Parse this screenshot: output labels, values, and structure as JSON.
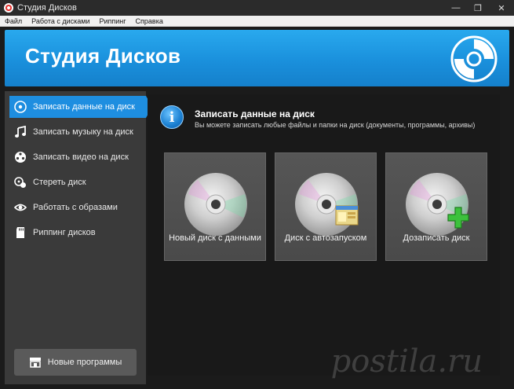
{
  "window": {
    "title": "Студия Дисков",
    "minimize": "—",
    "maximize": "❐",
    "close": "✕"
  },
  "menu": [
    "Файл",
    "Работа с дисками",
    "Риппинг",
    "Справка"
  ],
  "banner": {
    "title": "Студия Дисков"
  },
  "sidebar": {
    "items": [
      {
        "label": "Записать данные на диск",
        "icon": "disc-icon",
        "active": true
      },
      {
        "label": "Записать музыку на диск",
        "icon": "music-note-icon",
        "active": false
      },
      {
        "label": "Записать видео на диск",
        "icon": "film-reel-icon",
        "active": false
      },
      {
        "label": "Стереть диск",
        "icon": "erase-disc-icon",
        "active": false
      },
      {
        "label": "Работать с образами",
        "icon": "eye-icon",
        "active": false
      },
      {
        "label": "Риппинг дисков",
        "icon": "sd-card-icon",
        "active": false
      }
    ],
    "new_programs": "Новые программы"
  },
  "main": {
    "title": "Записать данные на диск",
    "description": "Вы можете записать любые файлы и папки на диск (документы, программы, архивы)",
    "tiles": [
      {
        "label": "Новый диск с данными",
        "badge": "none"
      },
      {
        "label": "Диск с автозапуском",
        "badge": "window-icon"
      },
      {
        "label": "Дозаписать диск",
        "badge": "plus-icon"
      }
    ]
  },
  "watermark": "postila.ru",
  "colors": {
    "accent": "#1e8ee0",
    "banner": "#1a90dc",
    "sidebar": "#3a3a3a",
    "panel": "#191919"
  }
}
